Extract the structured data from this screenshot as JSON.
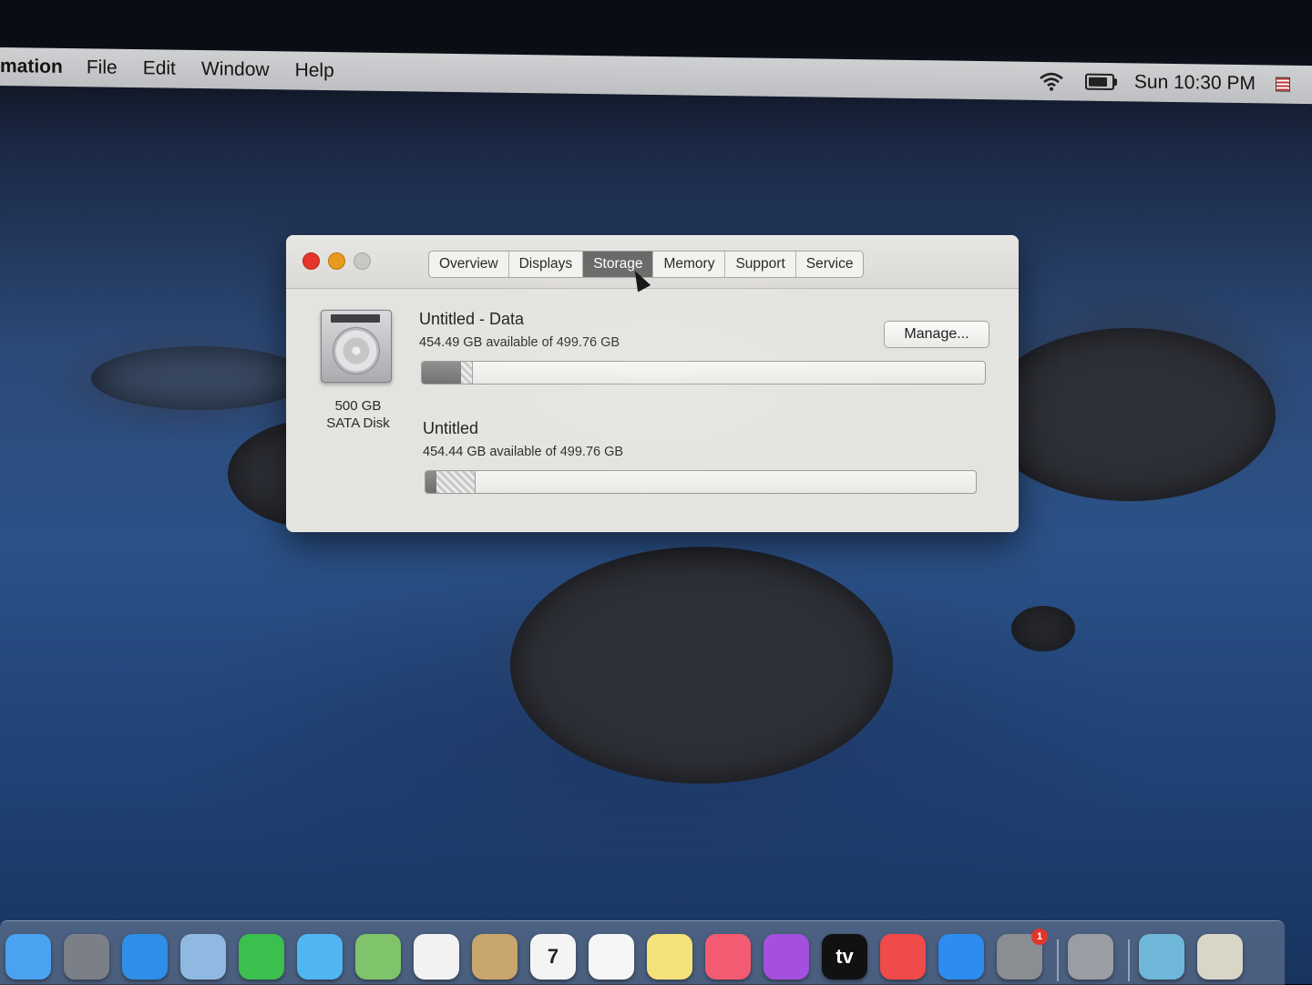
{
  "menubar": {
    "app_name": "mation",
    "items": [
      "File",
      "Edit",
      "Window",
      "Help"
    ],
    "clock": "Sun 10:30 PM",
    "icons": [
      "wifi-icon",
      "battery-icon",
      "input-source-flag-icon"
    ]
  },
  "window": {
    "tabs": [
      {
        "label": "Overview",
        "active": false
      },
      {
        "label": "Displays",
        "active": false
      },
      {
        "label": "Storage",
        "active": true
      },
      {
        "label": "Memory",
        "active": false
      },
      {
        "label": "Support",
        "active": false
      },
      {
        "label": "Service",
        "active": false
      }
    ],
    "disk": {
      "size_label": "500 GB",
      "type_label": "SATA Disk",
      "icon": "hard-disk-icon"
    },
    "manage_label": "Manage...",
    "volumes": [
      {
        "name": "Untitled - Data",
        "availability": "454.49 GB available of 499.76 GB",
        "used_fraction": 0.07,
        "other_fraction": 0.02
      },
      {
        "name": "Untitled",
        "availability": "454.44 GB available of 499.76 GB",
        "used_fraction": 0.02,
        "other_fraction": 0.07
      }
    ]
  },
  "dock": {
    "apps": [
      {
        "name": "finder-icon",
        "color": "#4aa3f0"
      },
      {
        "name": "launchpad-icon",
        "color": "#7b7f87"
      },
      {
        "name": "safari-icon",
        "color": "#2f8fe8"
      },
      {
        "name": "mail-icon",
        "color": "#8fb9e0"
      },
      {
        "name": "facetime-icon",
        "color": "#3bbf4e"
      },
      {
        "name": "messages-icon",
        "color": "#4fb6f2"
      },
      {
        "name": "maps-icon",
        "color": "#7fc36b"
      },
      {
        "name": "photos-icon",
        "color": "#f2f2f2"
      },
      {
        "name": "contacts-icon",
        "color": "#c9a66b"
      },
      {
        "name": "calendar-icon",
        "color": "#f4f4f4",
        "text": "7"
      },
      {
        "name": "reminders-icon",
        "color": "#f6f6f6"
      },
      {
        "name": "notes-icon",
        "color": "#f6e27a"
      },
      {
        "name": "music-icon",
        "color": "#f25b72"
      },
      {
        "name": "podcasts-icon",
        "color": "#a54fe0"
      },
      {
        "name": "tv-icon",
        "color": "#111111",
        "text": "tv"
      },
      {
        "name": "news-icon",
        "color": "#f04a4a"
      },
      {
        "name": "app-store-icon",
        "color": "#2d8cf0"
      },
      {
        "name": "system-preferences-icon",
        "color": "#8a8d92",
        "badge": "1"
      },
      {
        "name": "system-information-icon",
        "color": "#9a9ea4"
      },
      {
        "name": "downloads-folder-icon",
        "color": "#6fb7d9"
      },
      {
        "name": "trash-icon",
        "color": "#d9d6c8"
      }
    ]
  }
}
